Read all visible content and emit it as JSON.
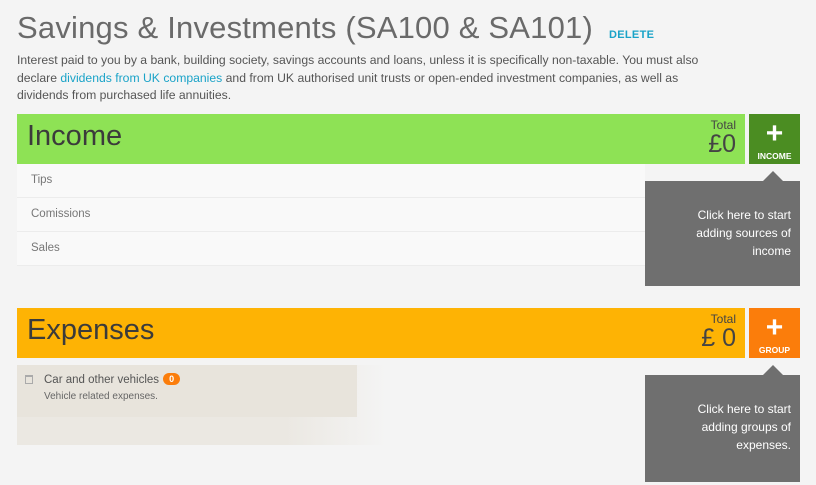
{
  "header": {
    "title": "Savings & Investments (SA100 & SA101)",
    "delete_label": "DELETE"
  },
  "description": {
    "part1": "Interest paid to you by a bank, building society, savings accounts and loans, unless it is specifically non-taxable. You must also declare ",
    "link": "dividends from UK companies",
    "part2": " and from UK authorised unit trusts or open-ended investment companies, as well as dividends from purchased life annuities."
  },
  "income": {
    "title": "Income",
    "total_label": "Total",
    "total_value": "£0",
    "add_icon": "plus-icon",
    "add_label": "INCOME",
    "color": "#8ee255",
    "button_color": "#4b8d22",
    "items": [
      {
        "label": "Tips"
      },
      {
        "label": "Comissions"
      },
      {
        "label": "Sales"
      }
    ],
    "tooltip": "Click here to start adding sources of income"
  },
  "expenses": {
    "title": "Expenses",
    "total_label": "Total",
    "total_value": "£ 0",
    "add_icon": "plus-icon",
    "add_label": "GROUP",
    "color": "#feb304",
    "button_color": "#fb7d0b",
    "groups": [
      {
        "name": "Car and other vehicles",
        "count": "0",
        "description": "Vehicle related expenses.",
        "icon": "trash-icon"
      }
    ],
    "tooltip": "Click here to start adding groups of expenses."
  }
}
